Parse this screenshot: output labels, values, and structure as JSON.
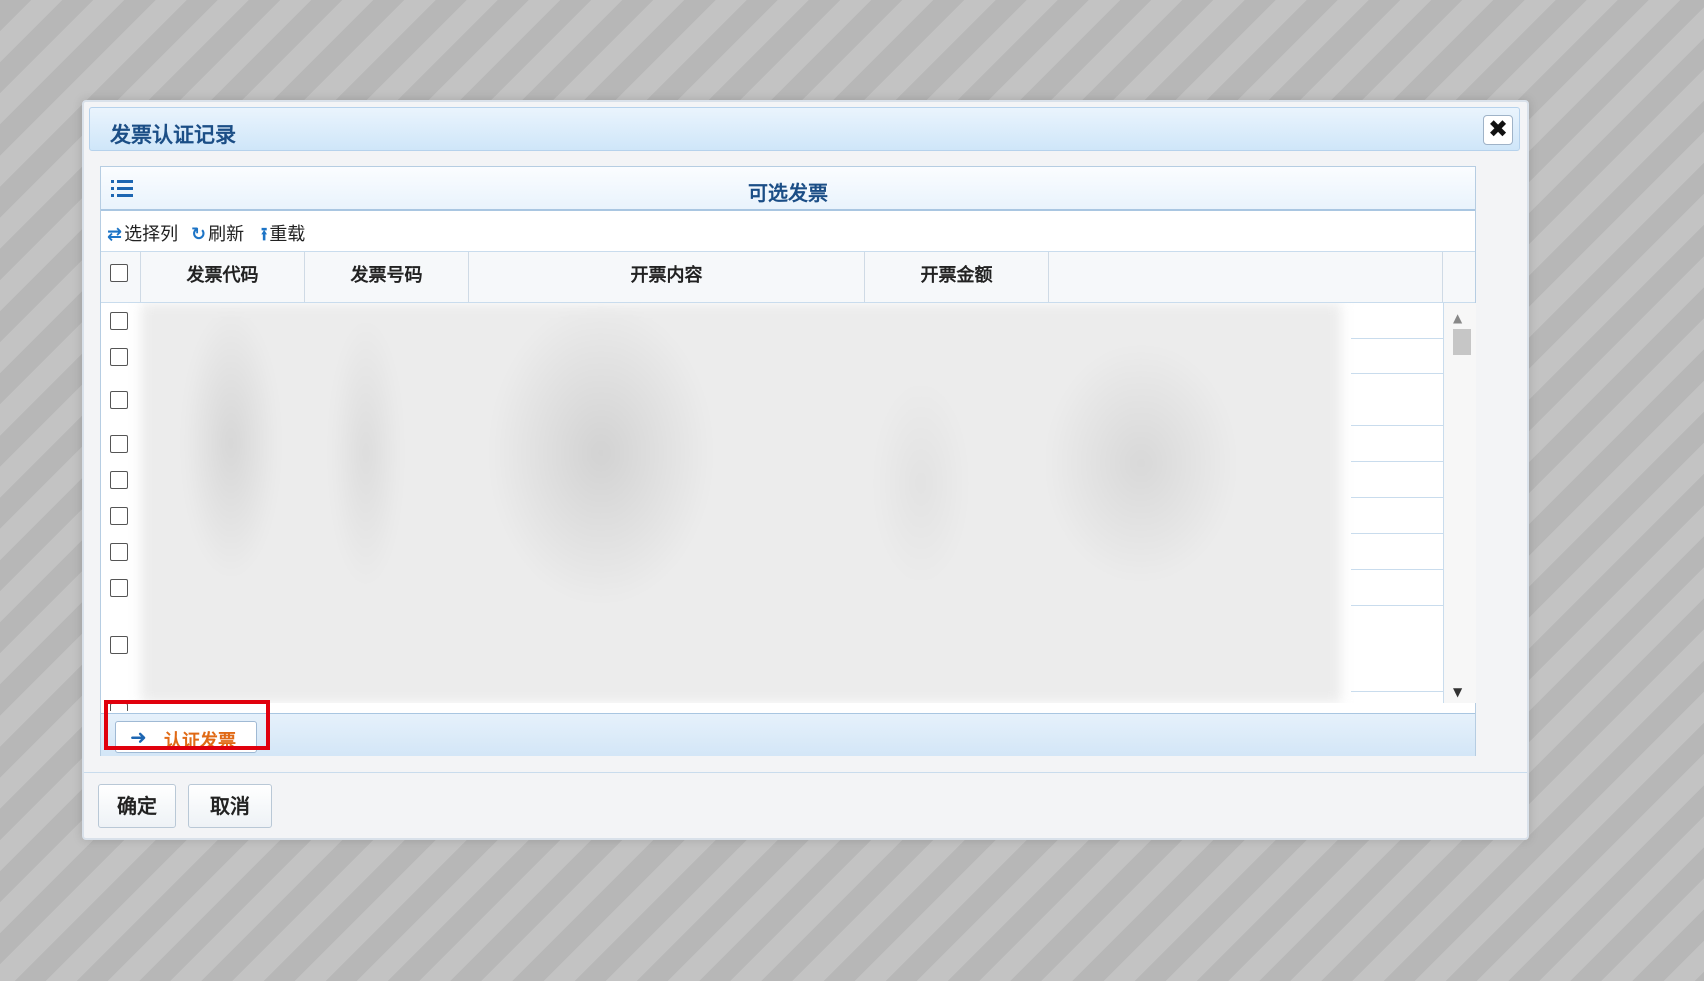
{
  "dialog": {
    "title": "发票认证记录",
    "close_icon": "close-icon"
  },
  "panel": {
    "title": "可选发票",
    "toolbar": {
      "choose_columns": "选择列",
      "refresh": "刷新",
      "reload": "重载"
    },
    "columns": [
      "发票代码",
      "发票号码",
      "开票内容",
      "开票金额",
      ""
    ],
    "row_count_visible": 10,
    "footer": {
      "verify_button": "认证发票"
    }
  },
  "buttons": {
    "ok": "确定",
    "cancel": "取消"
  },
  "colors": {
    "accent": "#1b4e86",
    "highlight": "#e0000d",
    "verify_text": "#e06a16"
  }
}
